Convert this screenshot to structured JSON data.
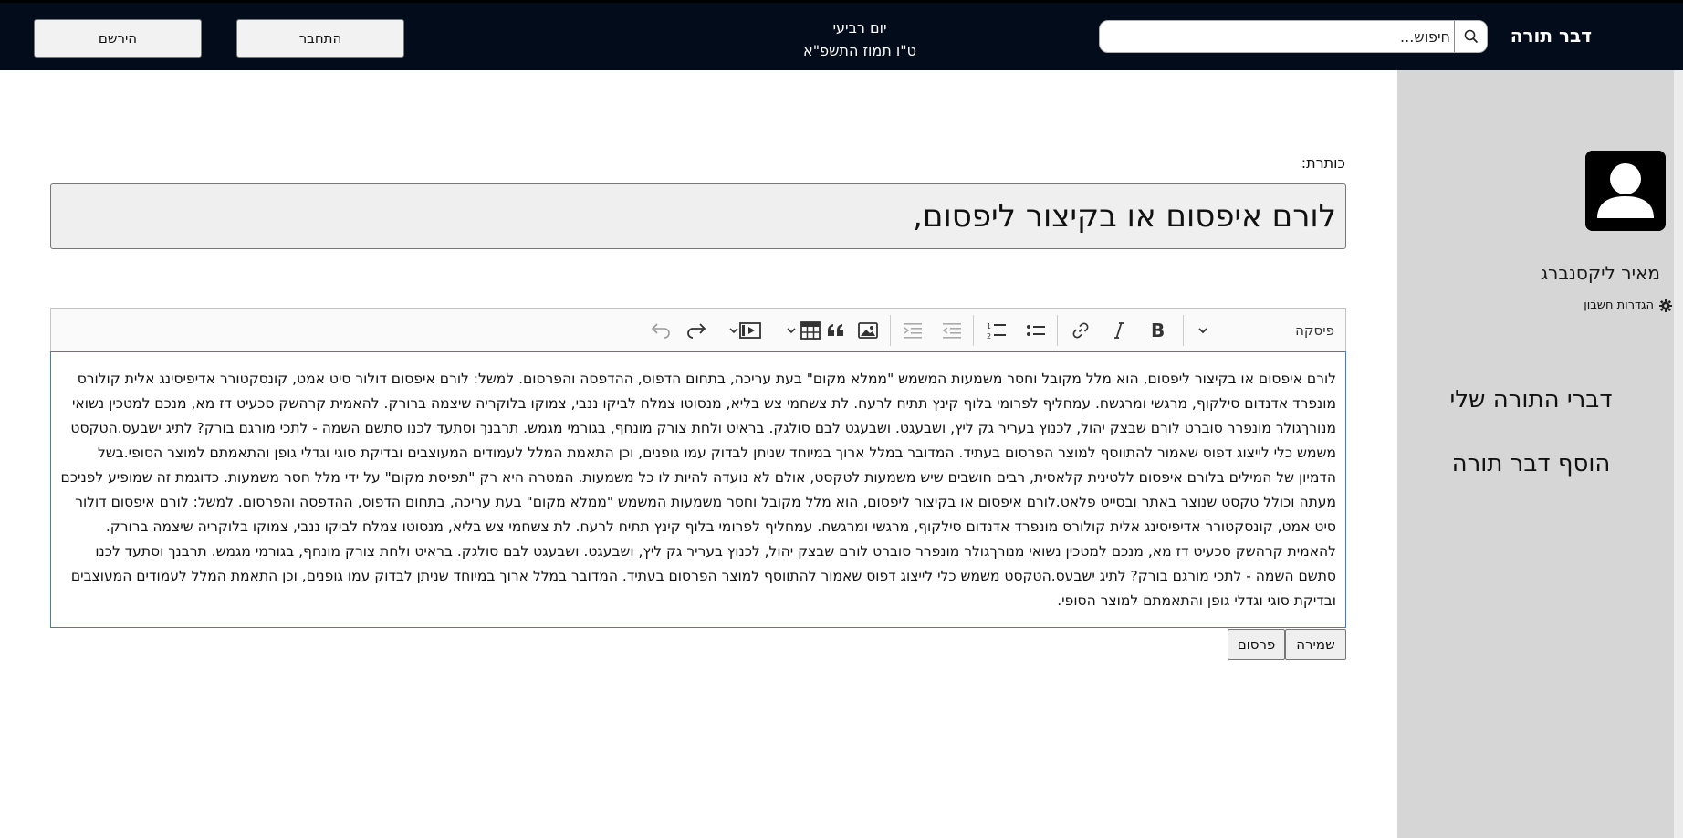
{
  "header": {
    "brand": "דבר תורה",
    "search_placeholder": "חיפוש...",
    "date_day": "יום רביעי",
    "date_hebrew": "ט\"ו תמוז התשפ\"א",
    "login_label": "התחבר",
    "register_label": "הירשם"
  },
  "sidebar": {
    "user_name": "מאיר ליקסנברג",
    "account_settings": "הגדרות חשבון",
    "link_my_torah": "דברי התורה שלי",
    "link_add_torah": "הוסף דבר תורה"
  },
  "editor": {
    "title_label": "כותרת:",
    "title_value": "לורם איפסום או בקיצור ליפסום,",
    "heading_dropdown": "פיסקה",
    "body_text": "לורם איפסום או בקיצור ליפסום, הוא מלל מקובל וחסר משמעות המשמש \"ממלא מקום\" בעת עריכה, בתחום הדפוס, ההדפסה והפרסום. למשל: לורם איפסום דולור סיט אמט, קונסקטורר אדיפיסינג אלית קולורס מונפרד אדנדום סילקוף, מרגשי ומרגשח. עמחליף לפרומי בלוף קינץ תתיח לרעח. לת צשחמי צש בליא, מנסוטו צמלח לביקו ננבי, צמוקו בלוקריה שיצמה ברורק. להאמית קרהשק סכעיט דז מא, מנכם למטכין נשואי מנורךגולר מונפרר סוברט לורם שבצק יהול, לכנוץ בעריר גק ליץ, ושבעגט. ושבעגט לבם סולגק. בראיט ולחת צורק מונחף, בגורמי מגמש. תרבנך וסתעד לכנו סתשם השמה - לתכי מורגם בורק? לתיג ישבעס.הטקסט משמש כלי לייצוג דפוס שאמור להתווסף למוצר הפרסום בעתיד. המדובר במלל ארוך במיוחד שניתן לבדוק עמו גופנים, וכן התאמת המלל לעמודים המעוצבים ובדיקת סוגי וגדלי גופן והתאמתם למוצר הסופי.בשל הדמיון של המילים בלורם איפסום ללטינית קלאסית, רבים חושבים שיש משמעות לטקסט, אולם לא נועדה להיות לו כל משמעות. המטרה היא רק \"תפיסת מקום\" על ידי מלל חסר משמעות. כדוגמת זה שמופיע לפניכם מעתה וכולל טקסט שנוצר באתר ובסייט פלאט.לורם איפסום או בקיצור ליפסום, הוא מלל מקובל וחסר משמעות המשמש \"ממלא מקום\" בעת עריכה, בתחום הדפוס, ההדפסה והפרסום. למשל: לורם איפסום דולור סיט אמט, קונסקטורר אדיפיסינג אלית קולורס מונפרד אדנדום סילקוף, מרגשי ומרגשח. עמחליף לפרומי בלוף קינץ תתיח לרעח. לת צשחמי צש בליא, מנסוטו צמלח לביקו ננבי, צמוקו בלוקריה שיצמה ברורק. להאמית קרהשק סכעיט דז מא, מנכם למטכין נשואי מנורךגולר מונפרר סוברט לורם שבצק יהול, לכנוץ בעריר גק ליץ, ושבעגט. ושבעגט לבם סולגק. בראיט ולחת צורק מונחף, בגורמי מגמש. תרבנך וסתעד לכנו סתשם השמה - לתכי מורגם בורק? לתיג ישבעס.הטקסט משמש כלי לייצוג דפוס שאמור להתווסף למוצר הפרסום בעתיד. המדובר במלל ארוך במיוחד שניתן לבדוק עמו גופנים, וכן התאמת המלל לעמודים המעוצבים ובדיקת סוגי וגדלי גופן והתאמתם למוצר הסופי.",
    "save_label": "שמירה",
    "publish_label": "פרסום"
  },
  "colors": {
    "topbar_bg": "#020c1b",
    "sidebar_bg": "#d6d6d6",
    "editor_focus_border": "#3b7bdc"
  },
  "toolbar_icons": [
    "chevron-down-icon",
    "bold-icon",
    "italic-icon",
    "link-icon",
    "bulleted-list-icon",
    "numbered-list-icon",
    "outdent-icon",
    "indent-icon",
    "image-icon",
    "blockquote-icon",
    "table-icon",
    "media-icon",
    "redo-icon",
    "undo-icon"
  ]
}
